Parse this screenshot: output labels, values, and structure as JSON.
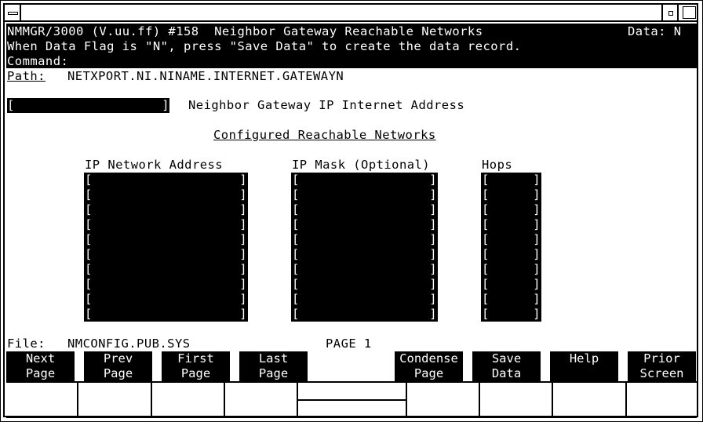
{
  "window": {
    "system_menu_icon": "system-menu-icon",
    "minimize_icon": "minimize-icon",
    "maximize_icon": "maximize-icon"
  },
  "header": {
    "title": "NMMGR/3000 (V.uu.ff) #158  Neighbor Gateway Reachable Networks",
    "data_flag": "Data: N",
    "message": "When Data Flag is \"N\", press \"Save Data\" to create the data record.",
    "command_label": "Command:"
  },
  "path": {
    "label": "Path:",
    "value": "NETXPORT.NI.NINAME.INTERNET.GATEWAYN"
  },
  "gateway_field": {
    "value": "",
    "label": "Neighbor Gateway IP Internet Address"
  },
  "section_title": "Configured Reachable Networks",
  "columns": {
    "network": "IP Network Address",
    "mask": "IP Mask (Optional)",
    "hops": "Hops"
  },
  "rows": [
    {
      "network": "",
      "mask": "",
      "hops": ""
    },
    {
      "network": "",
      "mask": "",
      "hops": ""
    },
    {
      "network": "",
      "mask": "",
      "hops": ""
    },
    {
      "network": "",
      "mask": "",
      "hops": ""
    },
    {
      "network": "",
      "mask": "",
      "hops": ""
    },
    {
      "network": "",
      "mask": "",
      "hops": ""
    },
    {
      "network": "",
      "mask": "",
      "hops": ""
    },
    {
      "network": "",
      "mask": "",
      "hops": ""
    },
    {
      "network": "",
      "mask": "",
      "hops": ""
    },
    {
      "network": "",
      "mask": "",
      "hops": ""
    }
  ],
  "footer": {
    "file_label": "File:",
    "file_value": "NMCONFIG.PUB.SYS",
    "page_label": "PAGE 1"
  },
  "function_keys": [
    {
      "label": "Next\nPage"
    },
    {
      "label": "Prev\nPage"
    },
    {
      "label": "First\nPage"
    },
    {
      "label": "Last\nPage"
    },
    {
      "label": ""
    },
    {
      "label": "Condense\nPage"
    },
    {
      "label": "Save\nData"
    },
    {
      "label": "Help"
    },
    {
      "label": "Prior\nScreen"
    }
  ]
}
